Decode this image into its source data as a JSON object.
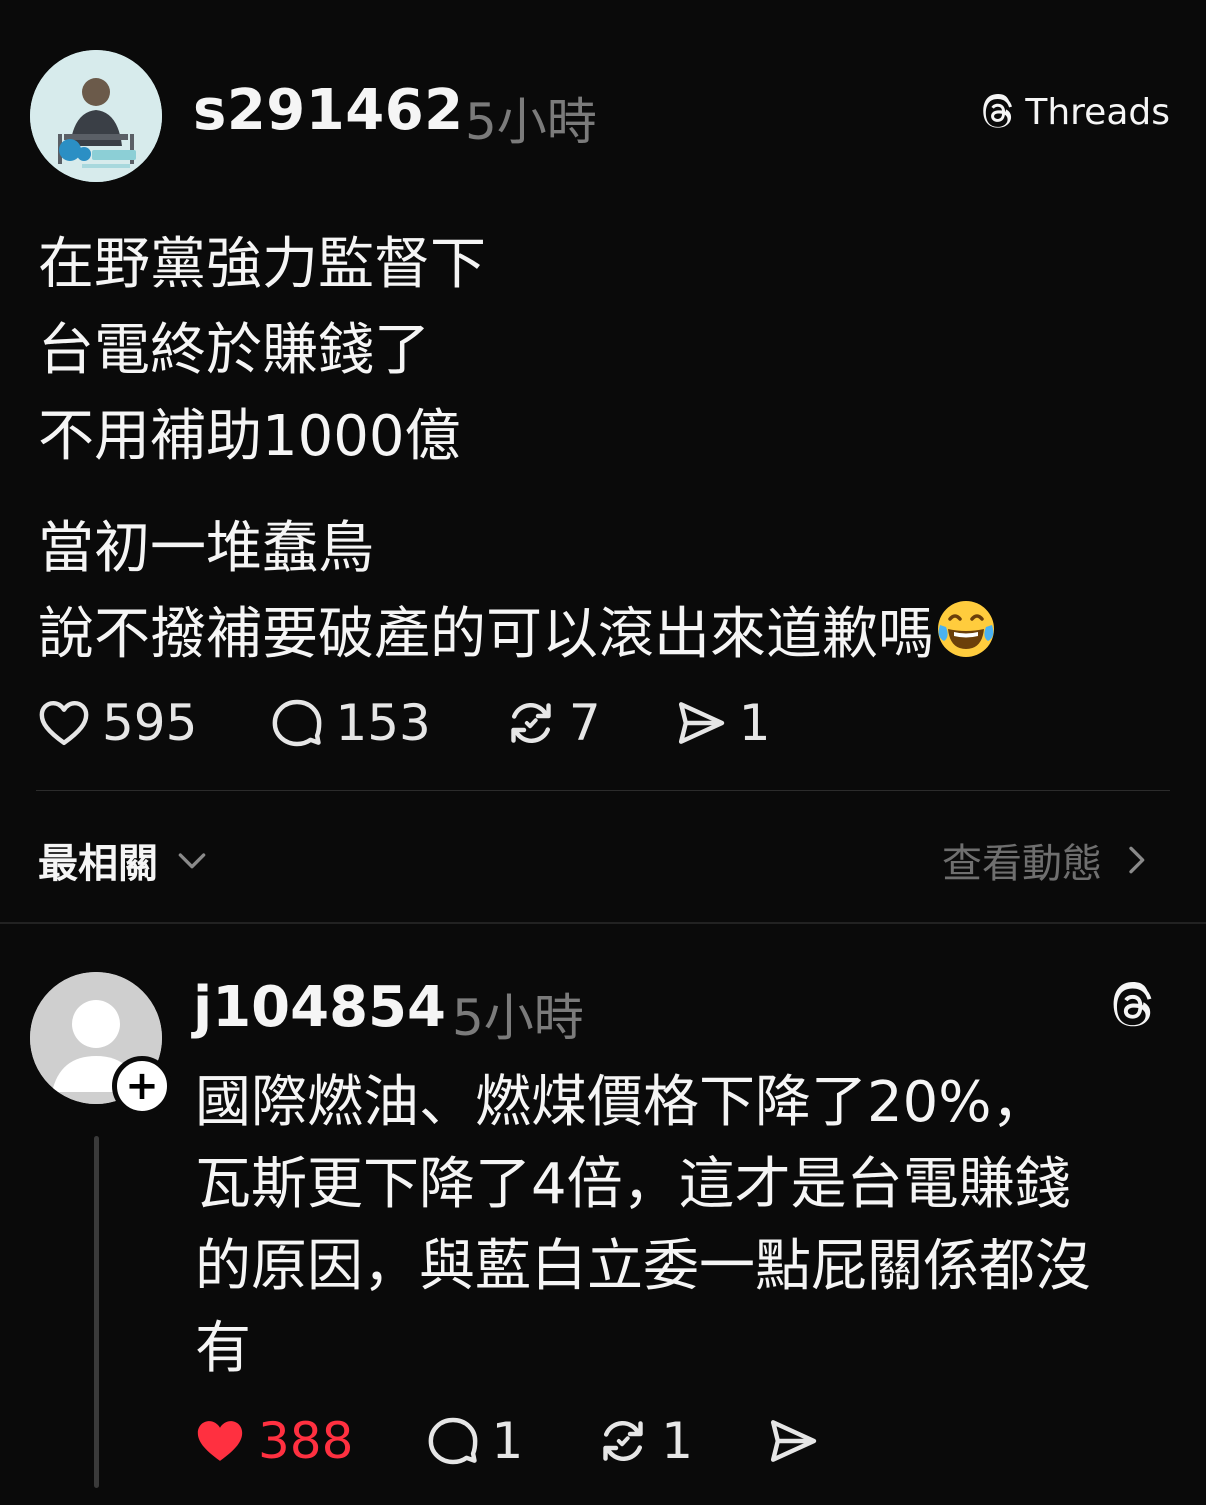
{
  "post": {
    "username": "s291462",
    "time": "5小時",
    "brand": "Threads",
    "lines": [
      "在野黨強力監督下",
      "台電終於賺錢了",
      "不用補助1000億"
    ],
    "lines2": [
      "當初一堆蠢鳥",
      "說不撥補要破產的可以滾出來道歉嗎"
    ],
    "emoji": "face-with-tears-of-joy",
    "likes": "595",
    "comments": "153",
    "reposts": "7",
    "shares": "1"
  },
  "sort": {
    "label": "最相關",
    "view_activity": "查看動態"
  },
  "reply": {
    "username": "j104854",
    "time": "5小時",
    "lines": [
      "國際燃油、燃煤價格下降了20%，",
      "瓦斯更下降了4倍，這才是台電賺錢",
      "的原因，與藍白立委一點屁關係都沒",
      "有"
    ],
    "likes": "388",
    "comments": "1",
    "reposts": "1",
    "like_color": "#ff3040"
  }
}
